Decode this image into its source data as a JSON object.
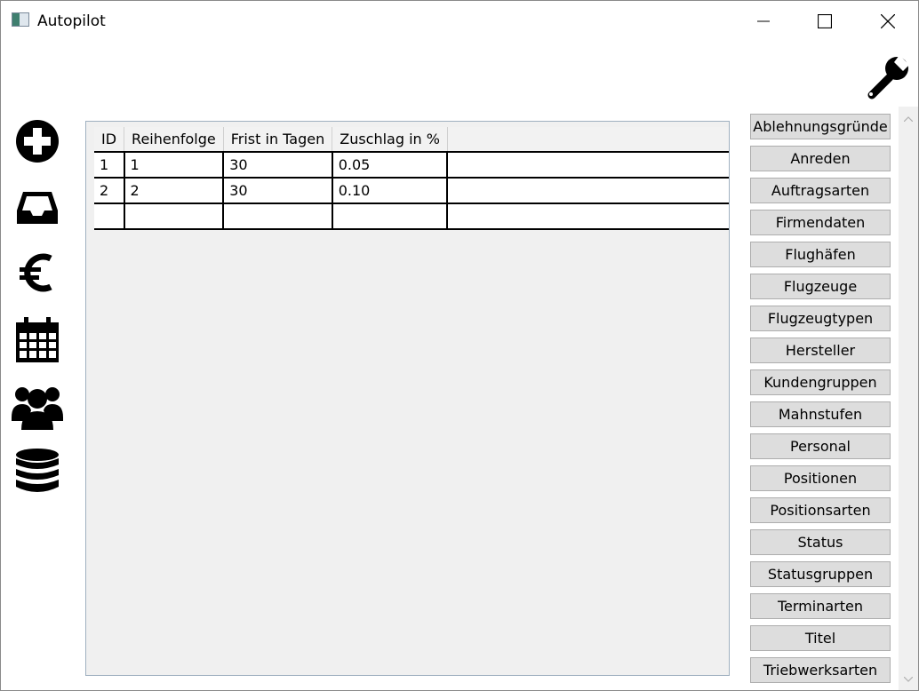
{
  "window": {
    "title": "Autopilot"
  },
  "sidebar": {
    "items": [
      "add-icon",
      "inbox-icon",
      "euro-icon",
      "calendar-icon",
      "users-icon",
      "database-icon"
    ]
  },
  "table": {
    "columns": [
      "ID",
      "Reihenfolge",
      "Frist in Tagen",
      "Zuschlag in %"
    ],
    "rows": [
      [
        "1",
        "1",
        "30",
        "0.05"
      ],
      [
        "2",
        "2",
        "30",
        "0.10"
      ],
      [
        "",
        "",
        "",
        ""
      ]
    ]
  },
  "nav": {
    "buttons": [
      "Ablehnungsgründe",
      "Anreden",
      "Auftragsarten",
      "Firmendaten",
      "Flughäfen",
      "Flugzeuge",
      "Flugzeugtypen",
      "Hersteller",
      "Kundengruppen",
      "Mahnstufen",
      "Personal",
      "Positionen",
      "Positionsarten",
      "Status",
      "Statusgruppen",
      "Terminarten",
      "Titel",
      "Triebwerksarten"
    ]
  }
}
